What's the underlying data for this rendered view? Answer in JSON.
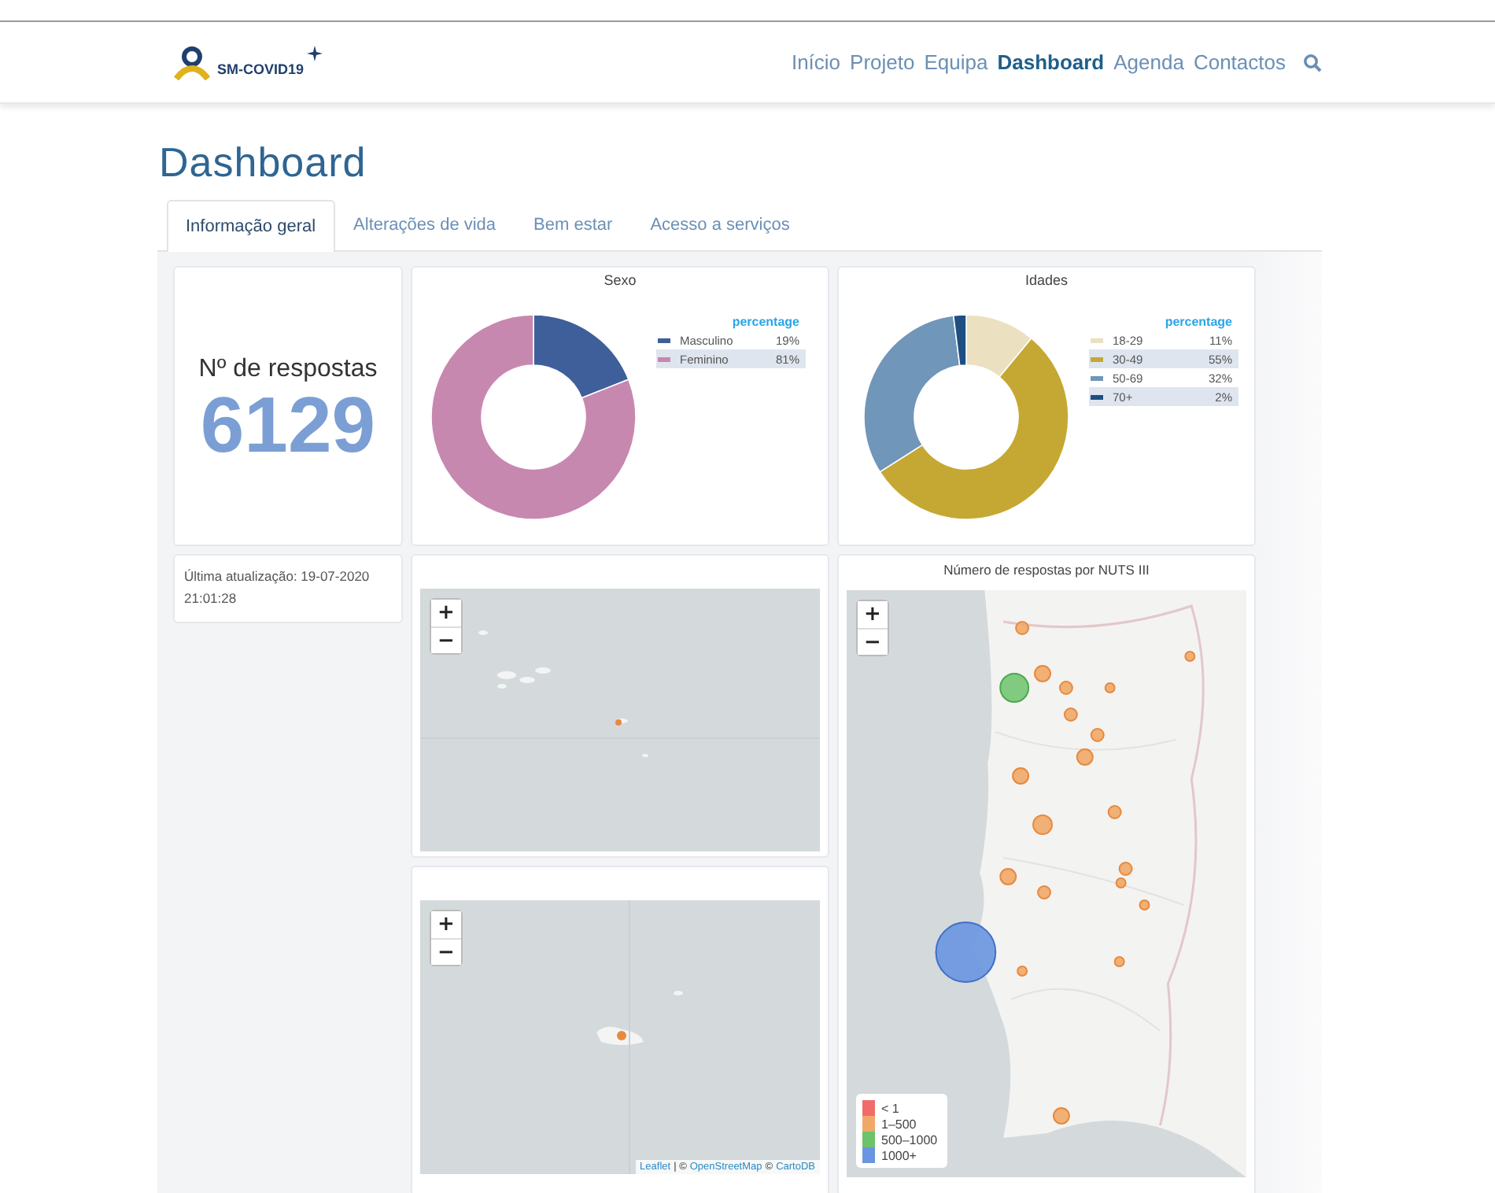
{
  "header": {
    "logo_text": "SM-COVID19",
    "nav": [
      {
        "label": "Início",
        "selected": false
      },
      {
        "label": "Projeto",
        "selected": false
      },
      {
        "label": "Equipa",
        "selected": false
      },
      {
        "label": "Dashboard",
        "selected": true
      },
      {
        "label": "Agenda",
        "selected": false
      },
      {
        "label": "Contactos",
        "selected": false
      }
    ]
  },
  "page_title": "Dashboard",
  "tabs": [
    {
      "label": "Informação geral",
      "selected": true
    },
    {
      "label": "Alterações de vida",
      "selected": false
    },
    {
      "label": "Bem estar",
      "selected": false
    },
    {
      "label": "Acesso a serviços",
      "selected": false
    }
  ],
  "responses": {
    "label": "Nº de respostas",
    "count": "6129"
  },
  "last_update": "Última atualização: 19-07-2020 21:01:28",
  "charts": [
    {
      "chart_data": {
        "type": "donut",
        "title": "Sexo",
        "categories": [
          "Masculino",
          "Feminino"
        ],
        "values": [
          19,
          81
        ],
        "legend": {
          "title": "percentage",
          "items": [
            {
              "value": "19%",
              "color": "#3f5f9a"
            },
            {
              "value": "81%",
              "color": "#c788b0"
            }
          ]
        }
      }
    },
    {
      "chart_data": {
        "type": "donut",
        "title": "Idades",
        "categories": [
          "18-29",
          "30-49",
          "50-69",
          "70+"
        ],
        "values": [
          11,
          55,
          32,
          2
        ],
        "legend": {
          "title": "percentage",
          "items": [
            {
              "value": "11%",
              "color": "#ebe0c0"
            },
            {
              "value": "55%",
              "color": "#c5a833"
            },
            {
              "value": "32%",
              "color": "#7096b9"
            },
            {
              "value": "2%",
              "color": "#1f4f82"
            }
          ]
        }
      }
    }
  ],
  "maps": [
    {
      "zoom_in": "+",
      "zoom_out": "−"
    },
    {
      "zoom_in": "+",
      "zoom_out": "−",
      "attribution": [
        {
          "kind": "link",
          "text": "Leaflet"
        },
        {
          "kind": "text",
          "text": "| ©"
        },
        {
          "kind": "link",
          "text": "OpenStreetMap"
        },
        {
          "kind": "text",
          "text": "©"
        },
        {
          "kind": "link",
          "text": "CartoDB"
        }
      ]
    },
    {
      "title": "Número de respostas por NUTS III",
      "zoom_in": "+",
      "zoom_out": "−",
      "legend": [
        {
          "label": "< 1",
          "color": "#f26b6b"
        },
        {
          "label": "1–500",
          "color": "#f0a868"
        },
        {
          "label": "500–1000",
          "color": "#6cc36c"
        },
        {
          "label": "1000+",
          "color": "#6a95e0"
        }
      ]
    }
  ]
}
